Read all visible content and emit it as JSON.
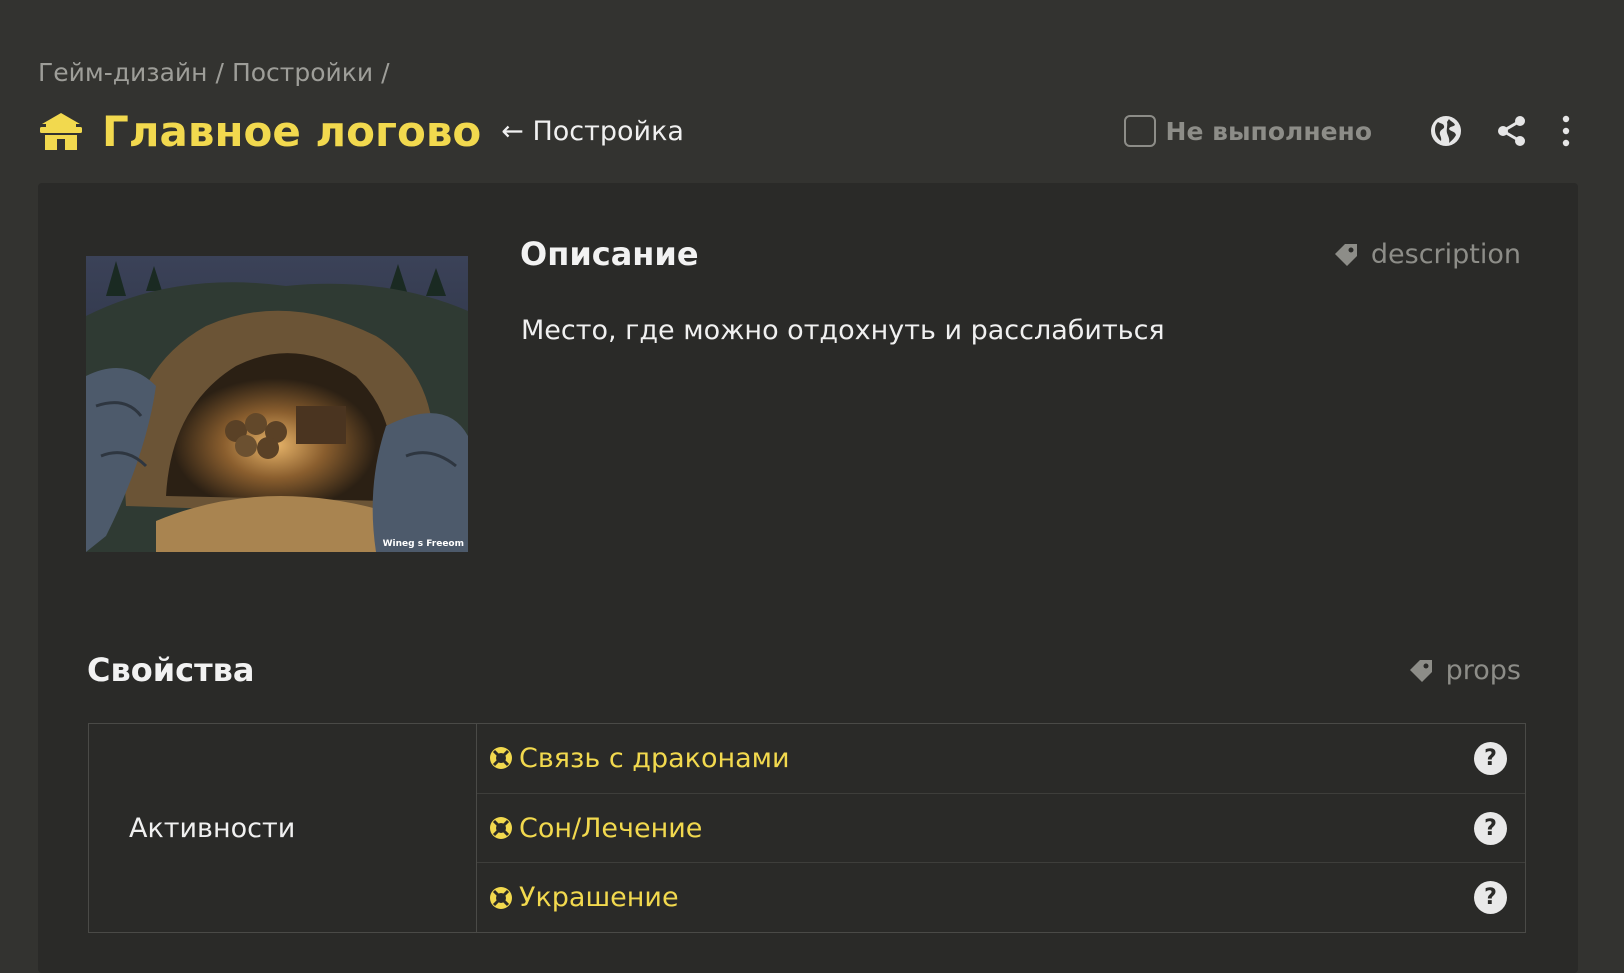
{
  "breadcrumb": {
    "items": [
      "Гейм-дизайн",
      "Постройки"
    ],
    "separator": "/"
  },
  "header": {
    "title": "Главное логово",
    "title_icon": "building-icon",
    "parent_link": "← Постройка",
    "status_label": "Не выполнено",
    "status_checked": false,
    "actions": [
      "globe-icon",
      "share-icon",
      "more-vertical-icon"
    ]
  },
  "card": {
    "image": {
      "watermark": "Wineg s Freeom"
    },
    "description": {
      "title": "Описание",
      "tag": "description",
      "text": "Место, где можно отдохнуть и расслабиться"
    },
    "props": {
      "title": "Свойства",
      "tag": "props",
      "rows": [
        {
          "key": "Активности",
          "values": [
            "Связь с драконами",
            "Сон/Лечение",
            "Украшение"
          ],
          "help": "?"
        }
      ]
    }
  },
  "colors": {
    "background": "#333330",
    "card": "#2a2a28",
    "accent": "#f2d94e",
    "muted": "#8d8d88"
  }
}
